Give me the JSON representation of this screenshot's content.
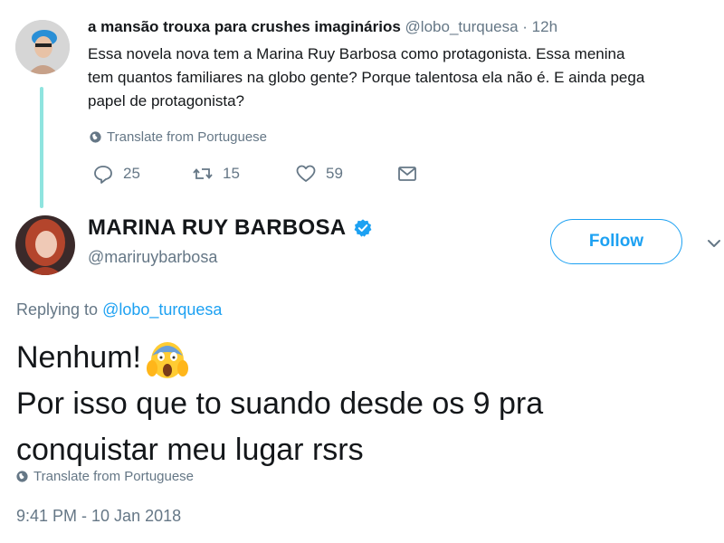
{
  "parent_tweet": {
    "display_name": "a mansão trouxa para crushes imaginários",
    "handle": "@lobo_turquesa",
    "separator": " · ",
    "time": "12h",
    "body": "Essa novela nova tem a Marina Ruy Barbosa como protagonista. Essa menina\ntem quantos familiares na globo gente? Porque talentosa ela não é. E ainda pega\npapel de protagonista?",
    "translate_label": "Translate from Portuguese",
    "actions": {
      "reply_count": "25",
      "retweet_count": "15",
      "like_count": "59"
    }
  },
  "main_tweet": {
    "display_name": "MARINA RUY BARBOSA",
    "handle": "@mariruybarbosa",
    "follow_label": "Follow",
    "replying_prefix": "Replying to ",
    "replying_to": "@lobo_turquesa",
    "body_line1": "Nenhum!",
    "body_line2": "Por isso que to suando desde os 9 pra",
    "body_line3": "conquistar meu lugar rsrs",
    "translate_label": "Translate from Portuguese",
    "timestamp": "9:41 PM - 10 Jan 2018"
  },
  "colors": {
    "accent": "#1da1f2",
    "thread_line": "#8fe4df",
    "muted": "#657786",
    "text": "#14171a"
  },
  "icons": [
    "globe-icon",
    "reply-icon",
    "retweet-icon",
    "like-icon",
    "dm-icon",
    "verified-badge-icon",
    "chevron-down-icon",
    "screaming-face-emoji"
  ]
}
